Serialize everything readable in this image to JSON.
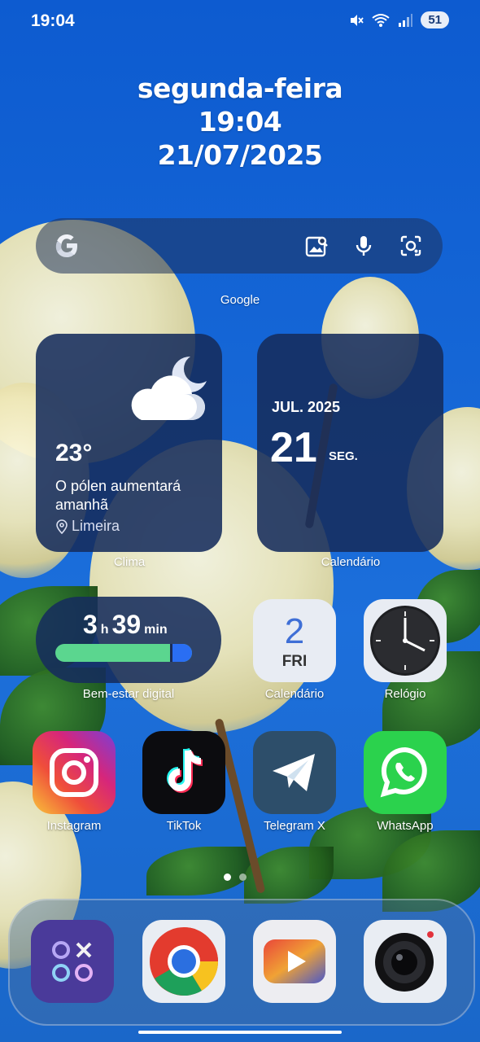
{
  "status_bar": {
    "time": "19:04",
    "battery": "51"
  },
  "lock_clock": {
    "weekday": "segunda-feira",
    "time": "19:04",
    "date": "21/07/2025"
  },
  "search_widget": {
    "label": "Google"
  },
  "weather_widget": {
    "temperature": "23°",
    "description": "O pólen aumentará amanhã",
    "location": "Limeira",
    "label": "Clima"
  },
  "calendar_widget": {
    "month": "JUL. 2025",
    "day": "21",
    "weekday": "SEG.",
    "label": "Calendário"
  },
  "wellbeing_widget": {
    "hours": "3",
    "hours_unit": "h",
    "minutes": "39",
    "minutes_unit": "min",
    "label": "Bem-estar digital"
  },
  "apps_row1": [
    {
      "label": "Calendário",
      "date_num": "2",
      "date_day": "FRI"
    },
    {
      "label": "Relógio"
    }
  ],
  "apps_row2": [
    {
      "label": "Instagram"
    },
    {
      "label": "TikTok"
    },
    {
      "label": "Telegram X"
    },
    {
      "label": "WhatsApp"
    }
  ],
  "dock": [
    {
      "name": "apps-folder"
    },
    {
      "name": "chrome"
    },
    {
      "name": "youtube"
    },
    {
      "name": "camera"
    }
  ]
}
